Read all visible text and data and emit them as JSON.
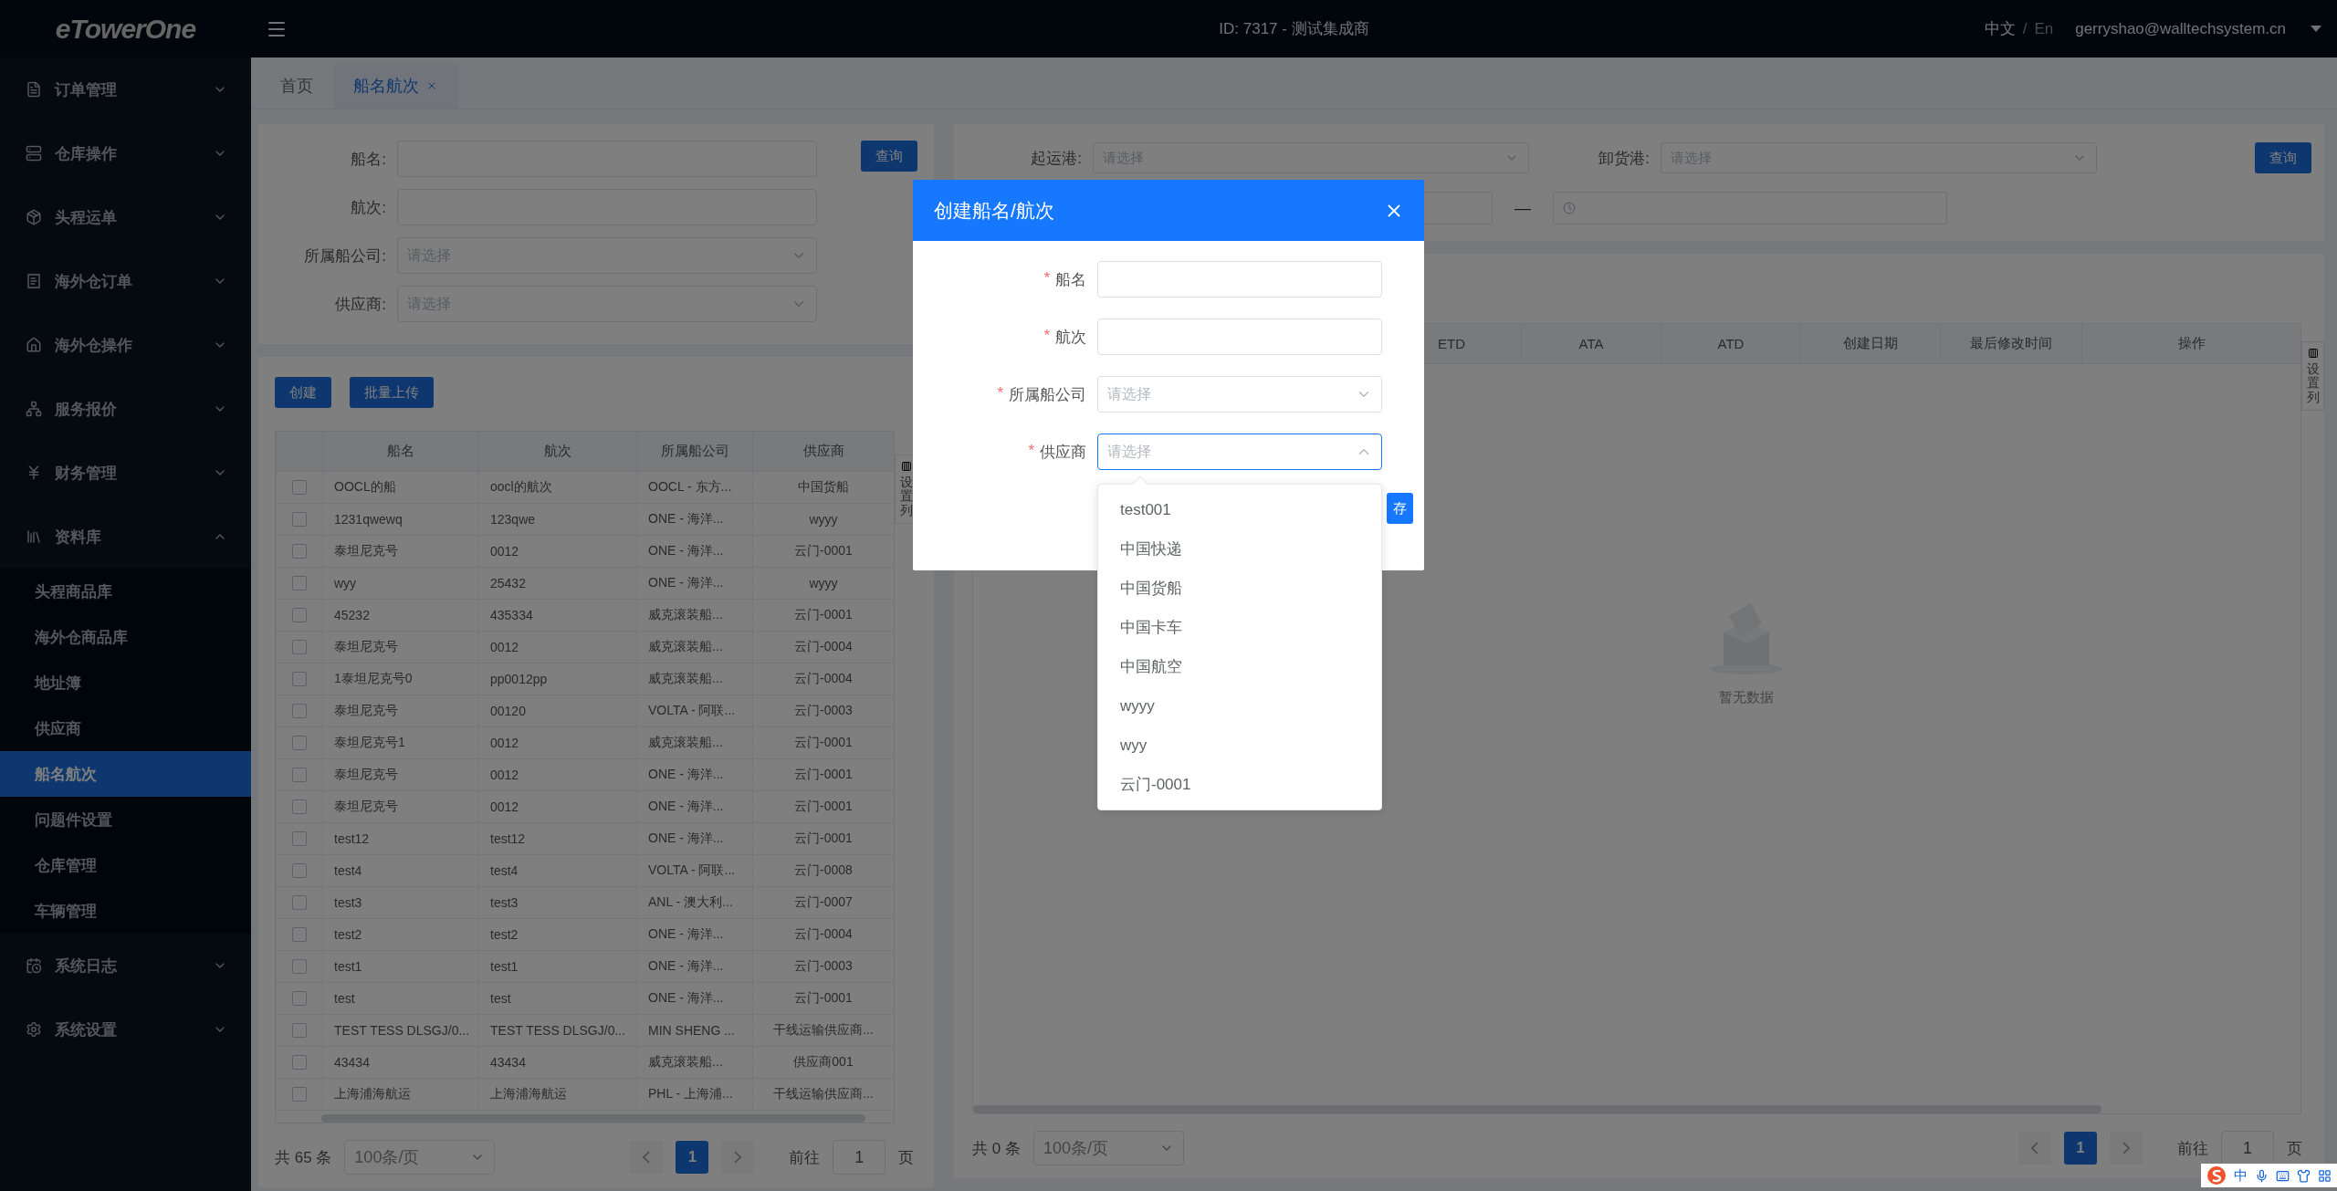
{
  "topbar": {
    "logo": "eTowerOne",
    "account": "ID: 7317 - 测试集成商",
    "languages": [
      {
        "label": "中文",
        "selected": true
      },
      {
        "label": "En",
        "selected": false
      }
    ],
    "language_separator": "/",
    "user": "gerryshao@walltechsystem.cn"
  },
  "sidebar": {
    "items": [
      {
        "label": "订单管理",
        "expanded": false
      },
      {
        "label": "仓库操作",
        "expanded": false
      },
      {
        "label": "头程运单",
        "expanded": false
      },
      {
        "label": "海外仓订单",
        "expanded": false
      },
      {
        "label": "海外仓操作",
        "expanded": false
      },
      {
        "label": "服务报价",
        "expanded": false
      },
      {
        "label": "财务管理",
        "expanded": false
      },
      {
        "label": "资料库",
        "expanded": true,
        "children": [
          {
            "label": "头程商品库",
            "selected": false
          },
          {
            "label": "海外仓商品库",
            "selected": false
          },
          {
            "label": "地址簿",
            "selected": false
          },
          {
            "label": "供应商",
            "selected": false
          },
          {
            "label": "船名航次",
            "selected": true
          },
          {
            "label": "问题件设置",
            "selected": false
          },
          {
            "label": "仓库管理",
            "selected": false
          },
          {
            "label": "车辆管理",
            "selected": false
          }
        ]
      },
      {
        "label": "系统日志",
        "expanded": false
      },
      {
        "label": "系统设置",
        "expanded": false
      }
    ]
  },
  "tabs": [
    {
      "label": "首页",
      "selected": false,
      "closable": false
    },
    {
      "label": "船名航次",
      "selected": true,
      "closable": true
    }
  ],
  "left_panel": {
    "filters": [
      {
        "label": "船名:",
        "kind": "text"
      },
      {
        "label": "航次:",
        "kind": "text"
      },
      {
        "label": "所属船公司:",
        "kind": "select",
        "placeholder": "请选择"
      },
      {
        "label": "供应商:",
        "kind": "select",
        "placeholder": "请选择"
      }
    ],
    "search_button": "查询",
    "actions": [
      "创建",
      "批量上传"
    ],
    "column_settings": "设置列",
    "table": {
      "columns": [
        "船名",
        "航次",
        "所属船公司",
        "供应商"
      ],
      "rows": [
        {
          "checked": false,
          "cells": [
            "OOCL的船",
            "oocl的航次",
            "OOCL - 东方...",
            "中国货船"
          ]
        },
        {
          "checked": false,
          "cells": [
            "1231qwewq",
            "123qwe",
            "ONE - 海洋...",
            "wyyy"
          ]
        },
        {
          "checked": false,
          "cells": [
            "泰坦尼克号",
            "0012",
            "ONE - 海洋...",
            "云门-0001"
          ]
        },
        {
          "checked": false,
          "cells": [
            "wyy",
            "25432",
            "ONE - 海洋...",
            "wyyy"
          ]
        },
        {
          "checked": false,
          "cells": [
            "45232",
            "435334",
            "威克滚装船...",
            "云门-0001"
          ]
        },
        {
          "checked": false,
          "cells": [
            "泰坦尼克号",
            "0012",
            "威克滚装船...",
            "云门-0004"
          ]
        },
        {
          "checked": false,
          "cells": [
            "1泰坦尼克号0",
            "pp0012pp",
            "威克滚装船...",
            "云门-0004"
          ]
        },
        {
          "checked": false,
          "cells": [
            "泰坦尼克号",
            "00120",
            "VOLTA - 阿联...",
            "云门-0003"
          ]
        },
        {
          "checked": false,
          "cells": [
            "泰坦尼克号1",
            "0012",
            "威克滚装船...",
            "云门-0001"
          ]
        },
        {
          "checked": false,
          "cells": [
            "泰坦尼克号",
            "0012",
            "ONE - 海洋...",
            "云门-0001"
          ]
        },
        {
          "checked": false,
          "cells": [
            "泰坦尼克号",
            "0012",
            "ONE - 海洋...",
            "云门-0001"
          ]
        },
        {
          "checked": false,
          "cells": [
            "test12",
            "test12",
            "ONE - 海洋...",
            "云门-0001"
          ]
        },
        {
          "checked": false,
          "cells": [
            "test4",
            "test4",
            "VOLTA - 阿联...",
            "云门-0008"
          ]
        },
        {
          "checked": false,
          "cells": [
            "test3",
            "test3",
            "ANL - 澳大利...",
            "云门-0007"
          ]
        },
        {
          "checked": false,
          "cells": [
            "test2",
            "test2",
            "ONE - 海洋...",
            "云门-0004"
          ]
        },
        {
          "checked": false,
          "cells": [
            "test1",
            "test1",
            "ONE - 海洋...",
            "云门-0003"
          ]
        },
        {
          "checked": false,
          "cells": [
            "test",
            "test",
            "ONE - 海洋...",
            "云门-0001"
          ]
        },
        {
          "checked": false,
          "cells": [
            "TEST TESS DLSGJ/0...",
            "TEST TESS DLSGJ/0...",
            "MIN SHENG ...",
            "干线运输供应商..."
          ]
        },
        {
          "checked": false,
          "cells": [
            "43434",
            "43434",
            "威克滚装船...",
            "供应商001"
          ]
        },
        {
          "checked": false,
          "cells": [
            "上海浦海航运",
            "上海浦海航运",
            "PHL - 上海浦...",
            "干线运输供应商..."
          ]
        }
      ]
    },
    "pagination": {
      "total": "共 65 条",
      "page_size": "100条/页",
      "pages": [
        {
          "label": "1",
          "selected": true
        }
      ],
      "goto_label": "前往",
      "goto_value": "1",
      "page_unit": "页"
    }
  },
  "right_panel": {
    "filters": [
      {
        "label": "起运港:",
        "kind": "select",
        "placeholder": "请选择"
      },
      {
        "label": "卸货港:",
        "kind": "select",
        "placeholder": "请选择"
      }
    ],
    "date_separator": "—",
    "search_button": "查询",
    "column_settings": "设置列",
    "table": {
      "columns": [
        "ETD",
        "ATA",
        "ATD",
        "创建日期",
        "最后修改时间",
        "操作"
      ],
      "empty_text": "暂无数据"
    },
    "pagination": {
      "total": "共 0 条",
      "page_size": "100条/页",
      "pages": [
        {
          "label": "1",
          "selected": true
        }
      ],
      "goto_label": "前往",
      "goto_value": "1",
      "page_unit": "页"
    }
  },
  "modal": {
    "title": "创建船名/航次",
    "required_mark": "*",
    "fields": [
      {
        "label": "船名",
        "required": true,
        "kind": "text"
      },
      {
        "label": "航次",
        "required": true,
        "kind": "text"
      },
      {
        "label": "所属船公司",
        "required": true,
        "kind": "select",
        "placeholder": "请选择",
        "open": false
      },
      {
        "label": "供应商",
        "required": true,
        "kind": "select",
        "placeholder": "请选择",
        "open": true,
        "options": [
          "test001",
          "中国快递",
          "中国货船",
          "中国卡车",
          "中国航空",
          "wyyy",
          "wyy",
          "云门-0001"
        ]
      }
    ],
    "save_button": "存"
  },
  "ime_toolbar": {
    "mode": "中"
  }
}
